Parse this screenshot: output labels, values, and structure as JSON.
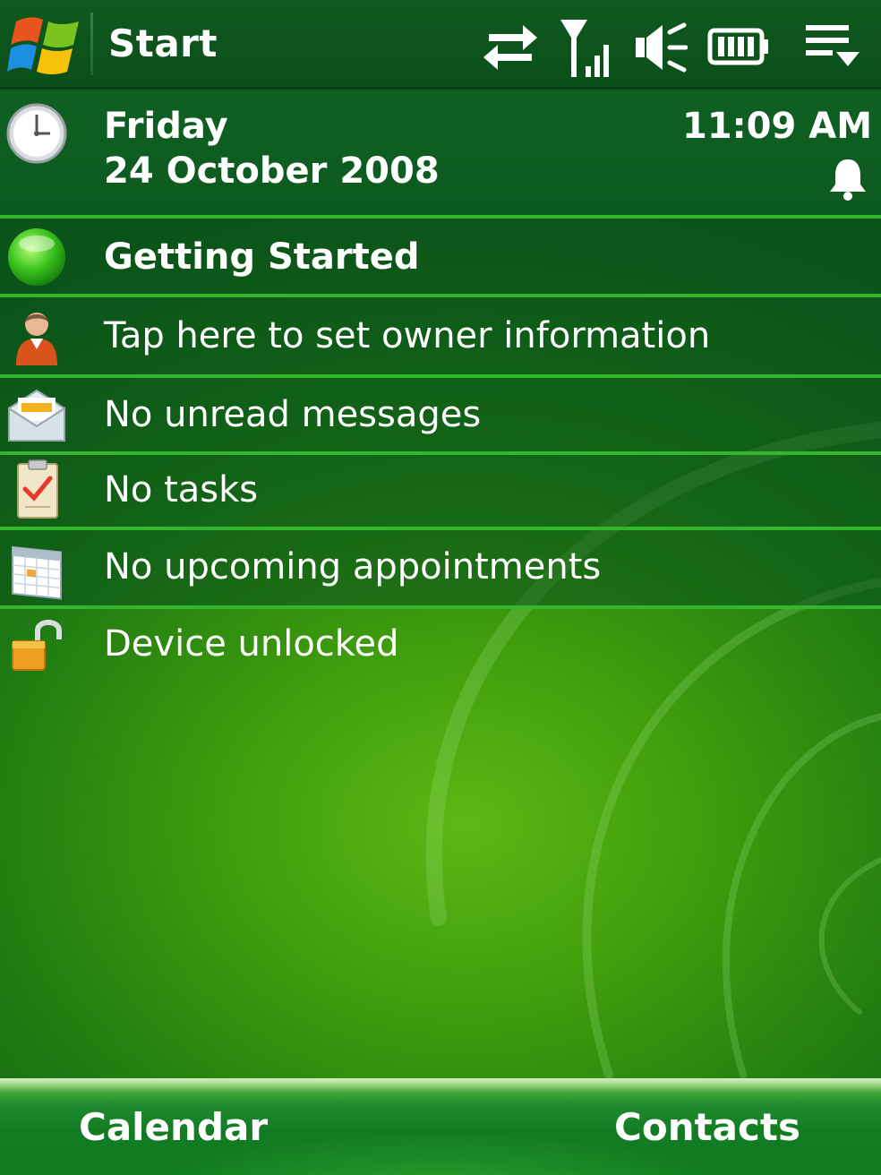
{
  "title_bar": {
    "title": "Start",
    "start_icon": "windows-flag-icon",
    "status_icons": [
      "connectivity-icon",
      "signal-icon",
      "volume-muted-icon",
      "battery-icon",
      "menu-overflow-icon"
    ]
  },
  "datetime": {
    "day": "Friday",
    "date": "24 October 2008",
    "time": "11:09 AM",
    "icons": [
      "clock-icon",
      "alarm-bell-icon"
    ]
  },
  "today_items": [
    {
      "id": "getting-started",
      "label": "Getting Started",
      "icon": "getting-started-icon"
    },
    {
      "id": "owner-info",
      "label": "Tap here to set owner information",
      "icon": "owner-person-icon"
    },
    {
      "id": "messages",
      "label": "No unread messages",
      "icon": "envelope-icon"
    },
    {
      "id": "tasks",
      "label": "No tasks",
      "icon": "clipboard-icon"
    },
    {
      "id": "appointments",
      "label": "No upcoming appointments",
      "icon": "calendar-icon"
    },
    {
      "id": "device-lock",
      "label": "Device unlocked",
      "icon": "padlock-open-icon"
    }
  ],
  "softkeys": {
    "left": "Calendar",
    "right": "Contacts"
  },
  "colors": {
    "title_bar_bg": "#0b4f1a",
    "divider": "#33b52e",
    "wallpaper_center": "#5cb814",
    "wallpaper_edge": "#0d5a18",
    "text": "#ffffff"
  }
}
